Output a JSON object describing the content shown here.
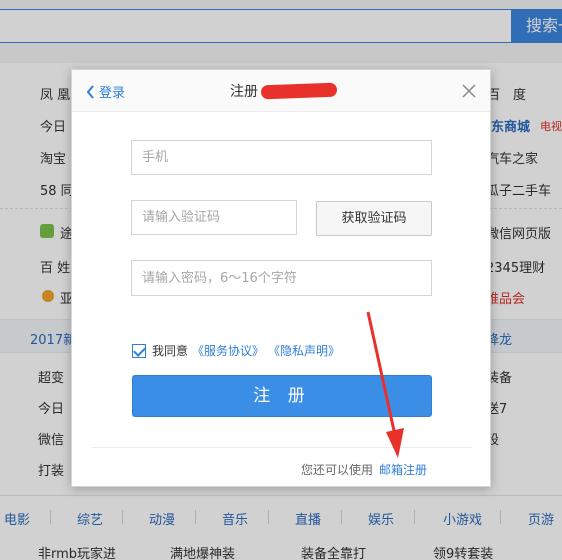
{
  "search": {
    "button_label": "搜索一"
  },
  "background_left": [
    {
      "text": "凤 凰"
    },
    {
      "text": "今日"
    },
    {
      "text": "淘宝"
    },
    {
      "text": "58 同"
    },
    {
      "text": "途"
    },
    {
      "text": "百 姓"
    },
    {
      "text": "亚"
    },
    {
      "text": "2017新"
    },
    {
      "text": "超变"
    },
    {
      "text": "今日"
    },
    {
      "text": "微信"
    },
    {
      "text": "打装"
    }
  ],
  "background_right": [
    {
      "text": "百　度"
    },
    {
      "text": "京东商城"
    },
    {
      "text": "电视"
    },
    {
      "text": "汽车之家"
    },
    {
      "text": "瓜子二手车"
    },
    {
      "text": "微信网页版"
    },
    {
      "text": "2345理财"
    },
    {
      "text": "唯品会"
    },
    {
      "text": "降龙"
    },
    {
      "text": "装备"
    },
    {
      "text": "送7"
    },
    {
      "text": "股"
    }
  ],
  "categories": [
    "电影",
    "综艺",
    "动漫",
    "音乐",
    "直播",
    "娱乐",
    "小游戏",
    "页游"
  ],
  "bottom_row": [
    "非rmb玩家进",
    "满地爆神装",
    "装备全靠打",
    "领9转套装"
  ],
  "modal": {
    "back_label": "登录",
    "title": "注册",
    "phone_placeholder": "手机",
    "code_placeholder": "请输入验证码",
    "get_code_label": "获取验证码",
    "password_placeholder": "请输入密码，6～16个字符",
    "agree_label": "我同意",
    "terms_link": "《服务协议》",
    "privacy_link": "《隐私声明》",
    "register_label": "注 册",
    "alt_text": "您还可以使用",
    "email_register_link": "邮箱注册"
  },
  "colors": {
    "accent": "#3a8ee6",
    "link": "#2f7fd8",
    "arrow": "#e8312a"
  }
}
